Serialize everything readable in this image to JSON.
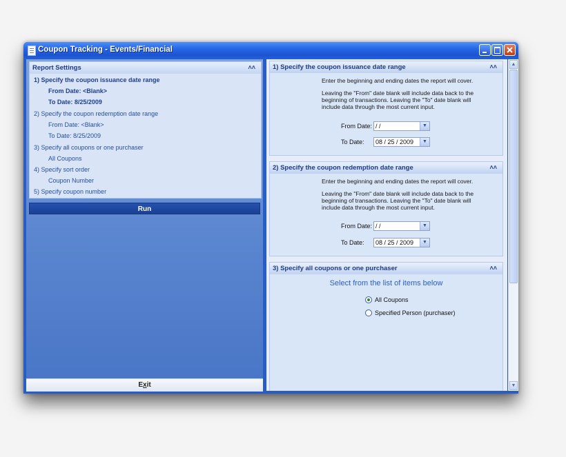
{
  "window": {
    "title": "Coupon Tracking - Events/Financial"
  },
  "left": {
    "header": "Report Settings",
    "items": [
      {
        "text": "1)  Specify the coupon issuance date range",
        "bold": true
      },
      {
        "text": "From Date:  <Blank>",
        "bold": true
      },
      {
        "text": "To Date:  8/25/2009",
        "bold": true
      },
      {
        "text": "2)  Specify the coupon redemption date range"
      },
      {
        "text": "From Date:  <Blank>"
      },
      {
        "text": "To Date:  8/25/2009"
      },
      {
        "text": "3)  Specify all coupons or one purchaser"
      },
      {
        "text": "All Coupons"
      },
      {
        "text": "4)  Specify sort order"
      },
      {
        "text": "Coupon Number"
      },
      {
        "text": "5)  Specify coupon number"
      }
    ],
    "run_label": "Run",
    "exit_pre": "E",
    "exit_u": "x",
    "exit_post": "it"
  },
  "panels": [
    {
      "header": "1)  Specify the coupon issuance date range",
      "line1": "Enter the beginning and ending dates the report will cover.",
      "line2": "Leaving the \"From\" date blank will include data back to the",
      "line3": "beginning of transactions. Leaving the \"To\" date blank will",
      "line4": "include data through the most current input.",
      "from_label": "From Date:",
      "from_value": "    /     /",
      "to_label": "To Date:",
      "to_value": "08 / 25 / 2009"
    },
    {
      "header": "2)  Specify the coupon redemption date range",
      "line1": "Enter the beginning and ending dates the report will cover.",
      "line2": "Leaving the \"From\" date blank will include data back to the",
      "line3": "beginning of transactions. Leaving the \"To\" date blank will",
      "line4": "include data through the most current input.",
      "from_label": "From Date:",
      "from_value": "    /     /",
      "to_label": "To Date:",
      "to_value": "08 / 25 / 2009"
    },
    {
      "header": "3)  Specify all coupons or one purchaser",
      "prompt": "Select from the list of items below",
      "options": [
        {
          "label": "All Coupons",
          "selected": true
        },
        {
          "label": "Specified Person (purchaser)",
          "selected": false
        }
      ]
    }
  ]
}
